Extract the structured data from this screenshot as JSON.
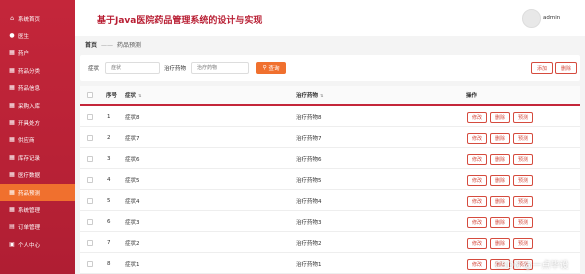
{
  "sidebar": {
    "items": [
      {
        "icon": "home-icon",
        "glyph": "⌂",
        "label": "系统首页"
      },
      {
        "icon": "person-icon",
        "glyph": "●",
        "label": "医生"
      },
      {
        "icon": "grid-icon",
        "glyph": "▦",
        "label": "药户"
      },
      {
        "icon": "grid-icon",
        "glyph": "▦",
        "label": "药品分类"
      },
      {
        "icon": "grid-icon",
        "glyph": "▦",
        "label": "药品信息"
      },
      {
        "icon": "grid-icon",
        "glyph": "▦",
        "label": "采购入库"
      },
      {
        "icon": "grid-icon",
        "glyph": "▦",
        "label": "开具处方"
      },
      {
        "icon": "grid-icon",
        "glyph": "▦",
        "label": "供应商"
      },
      {
        "icon": "grid-icon",
        "glyph": "▦",
        "label": "库存记录"
      },
      {
        "icon": "grid-icon",
        "glyph": "▦",
        "label": "医疗数据"
      },
      {
        "icon": "grid-icon",
        "glyph": "▦",
        "label": "药品预测"
      },
      {
        "icon": "grid-icon",
        "glyph": "▦",
        "label": "系统管理"
      },
      {
        "icon": "cart-icon",
        "glyph": "▤",
        "label": "订单管理"
      },
      {
        "icon": "user-center-icon",
        "glyph": "▣",
        "label": "个人中心"
      }
    ],
    "active_index": 10
  },
  "header": {
    "title": "基于Java医院药品管理系统的设计与实现",
    "user": "admin"
  },
  "breadcrumb": {
    "home": "首页",
    "separator": "——",
    "current": "药品预测"
  },
  "filter": {
    "symptom_label": "症状",
    "symptom_placeholder": "症状",
    "drug_label": "治疗药物",
    "drug_placeholder": "治疗药物",
    "search_label": "查询",
    "search_icon": "search-icon",
    "add_label": "添加",
    "delete_label": "删除"
  },
  "table": {
    "headers": {
      "no": "序号",
      "symptom": "症状",
      "drug": "治疗药物",
      "action": "操作"
    },
    "actions": {
      "edit": "修改",
      "delete": "删除",
      "predict": "预测"
    },
    "rows": [
      {
        "no": "1",
        "symptom": "症状8",
        "drug": "治疗药物8"
      },
      {
        "no": "2",
        "symptom": "症状7",
        "drug": "治疗药物7"
      },
      {
        "no": "3",
        "symptom": "症状6",
        "drug": "治疗药物6"
      },
      {
        "no": "4",
        "symptom": "症状5",
        "drug": "治疗药物5"
      },
      {
        "no": "5",
        "symptom": "症状4",
        "drug": "治疗药物4"
      },
      {
        "no": "6",
        "symptom": "症状3",
        "drug": "治疗药物3"
      },
      {
        "no": "7",
        "symptom": "症状2",
        "drug": "治疗药物2"
      },
      {
        "no": "8",
        "symptom": "症状1",
        "drug": "治疗药物1"
      }
    ]
  },
  "watermark": "CSDN @一点毕设",
  "colors": {
    "primary": "#c4263a",
    "accent": "#f0702e"
  }
}
